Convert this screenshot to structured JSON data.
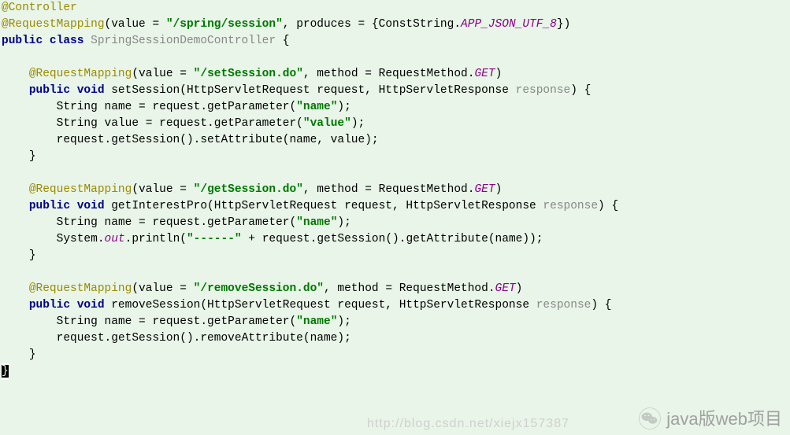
{
  "code": {
    "annotation_controller": "@Controller",
    "reqmap_class": "@RequestMapping",
    "reqmap_class_args_prefix": "(value = ",
    "class_path": "\"/spring/session\"",
    "produces_prefix": ", produces = {ConstString.",
    "app_json": "APP_JSON_UTF_8",
    "produces_suffix": "})",
    "class_decl_pub": "public class",
    "class_name": " SpringSessionDemoController ",
    "open_brace": "{",
    "m1_reqmap": "@RequestMapping",
    "m1_reqmap_args_pre": "(value = ",
    "m1_path": "\"/setSession.do\"",
    "m1_reqmap_args_mid": ", method = RequestMethod.",
    "m1_get": "GET",
    "m1_close": ")",
    "m1_sig_pub": "public void",
    "m1_sig_name": " setSession(HttpServletRequest request, HttpServletResponse ",
    "m1_resp": "response",
    "m1_sig_end": ") {",
    "m1_l1a": "String name = request.getParameter(",
    "m1_l1b": "\"name\"",
    "m1_l1c": ");",
    "m1_l2a": "String value = request.getParameter(",
    "m1_l2b": "\"value\"",
    "m1_l2c": ");",
    "m1_l3": "request.getSession().setAttribute(name, value);",
    "m1_close_brace": "}",
    "m2_reqmap": "@RequestMapping",
    "m2_reqmap_args_pre": "(value = ",
    "m2_path": "\"/getSession.do\"",
    "m2_reqmap_args_mid": ", method = RequestMethod.",
    "m2_get": "GET",
    "m2_close": ")",
    "m2_sig_pub": "public void",
    "m2_sig_name": " getInterestPro(HttpServletRequest request, HttpServletResponse ",
    "m2_resp": "response",
    "m2_sig_end": ") {",
    "m2_l1a": "String name = request.getParameter(",
    "m2_l1b": "\"name\"",
    "m2_l1c": ");",
    "m2_l2a": "System.",
    "m2_l2b": "out",
    "m2_l2c": ".println(",
    "m2_l2d": "\"------\"",
    "m2_l2e": " + request.getSession().getAttribute(name));",
    "m2_close_brace": "}",
    "m3_reqmap": "@RequestMapping",
    "m3_reqmap_args_pre": "(value = ",
    "m3_path": "\"/removeSession.do\"",
    "m3_reqmap_args_mid": ", method = RequestMethod.",
    "m3_get": "GET",
    "m3_close": ")",
    "m3_sig_pub": "public void",
    "m3_sig_name": " removeSession(HttpServletRequest request, HttpServletResponse ",
    "m3_resp": "response",
    "m3_sig_end": ") {",
    "m3_l1a": "String name = request.getParameter(",
    "m3_l1b": "\"name\"",
    "m3_l1c": ");",
    "m3_l2": "request.getSession().removeAttribute(name);",
    "m3_close_brace": "}",
    "final_brace": "}"
  },
  "watermark": {
    "text": "java版web项目",
    "url": "http://blog.csdn.net/xiejx157387"
  }
}
